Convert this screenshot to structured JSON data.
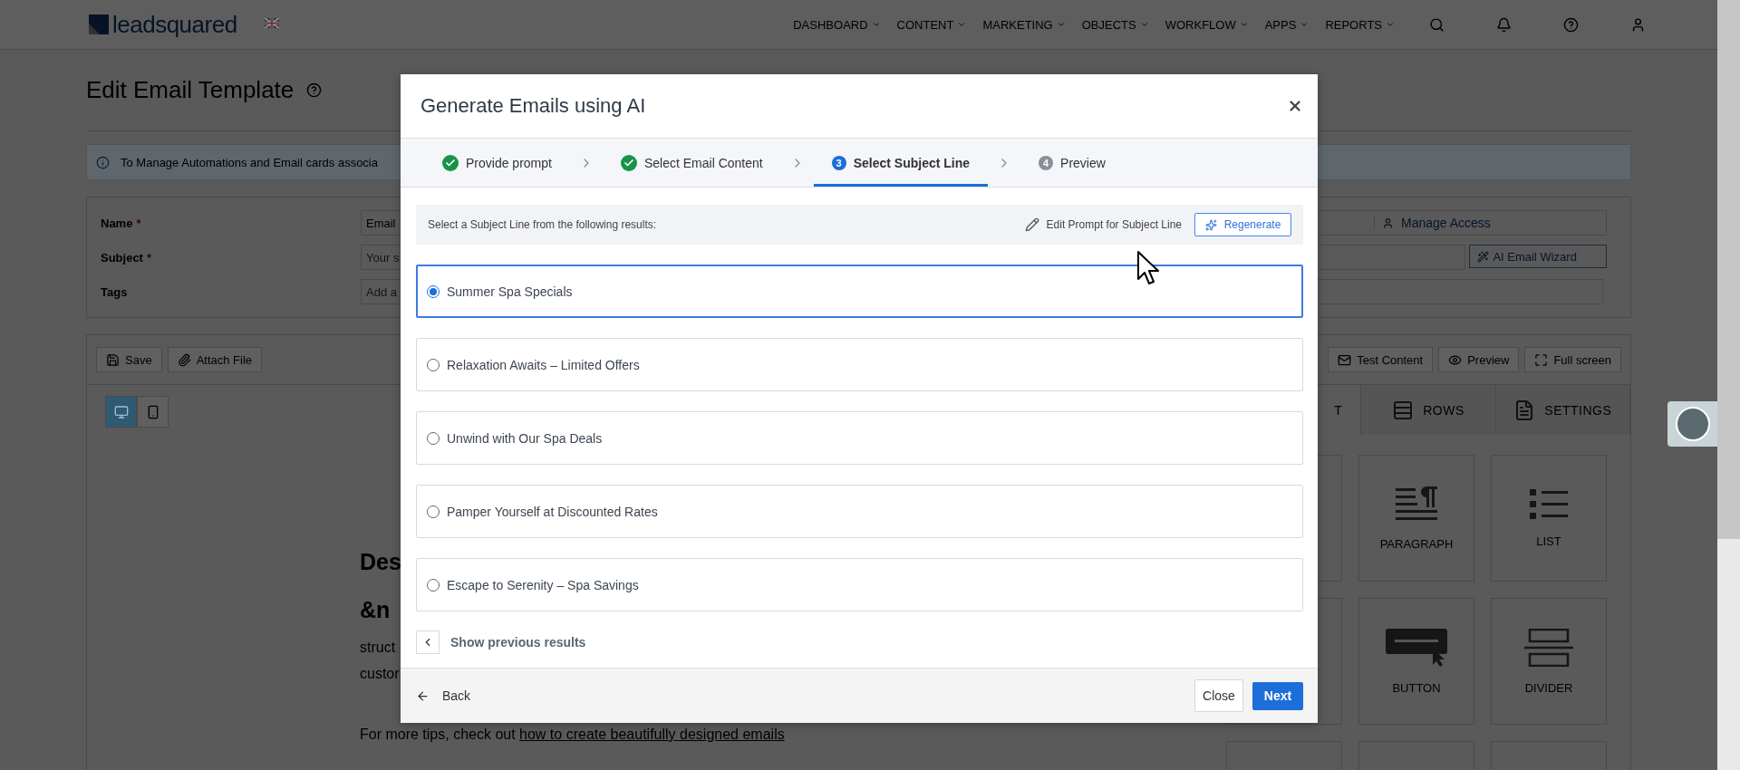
{
  "top_nav": {
    "logo": "leadsquared",
    "menu": [
      "DASHBOARD",
      "CONTENT",
      "MARKETING",
      "OBJECTS",
      "WORKFLOW",
      "APPS",
      "REPORTS"
    ]
  },
  "page": {
    "title": "Edit Email Template",
    "info_banner": "To Manage Automations and Email cards associa",
    "form": {
      "fields": [
        {
          "label": "Name",
          "mark": "*",
          "value": "Email"
        },
        {
          "label": "Subject",
          "mark": "*",
          "placeholder": "Your s"
        },
        {
          "label": "Tags",
          "placeholder": "Add a"
        }
      ],
      "manage_access": "Manage Access",
      "ai_wizard": "AI Email Wizard"
    },
    "toolbar": {
      "left": [
        {
          "kind": "save",
          "label": "Save"
        },
        {
          "kind": "attach",
          "label": "Attach File"
        }
      ],
      "right": [
        {
          "kind": "test",
          "label": "Test Content"
        },
        {
          "kind": "preview",
          "label": "Preview"
        },
        {
          "kind": "fullscreen",
          "label": "Full screen"
        }
      ]
    },
    "device_toggle": [
      {
        "kind": "desktop",
        "selected": true
      },
      {
        "kind": "mobile",
        "selected": false
      }
    ],
    "email_canvas": {
      "headings": [
        "Des",
        "&n"
      ],
      "body_lines": [
        "struct",
        "custor"
      ],
      "tip": "For more tips, check out ",
      "tip_link": "how to create beautifully designed emails"
    },
    "sidebar": {
      "tabs": [
        {
          "label": "T",
          "selected": true
        },
        {
          "label": "ROWS",
          "selected": false
        },
        {
          "label": "SETTINGS",
          "selected": false
        }
      ],
      "blocks": [
        {
          "kind": "paragraph",
          "label": "PARAGRAPH"
        },
        {
          "kind": "list",
          "label": "LIST"
        },
        {
          "kind": "button",
          "label": "BUTTON"
        },
        {
          "kind": "divider",
          "label": "DIVIDER"
        }
      ]
    }
  },
  "modal": {
    "title": "Generate Emails using AI",
    "steps": [
      {
        "label": "Provide prompt",
        "completed": true,
        "selected": false
      },
      {
        "label": "Select Email Content",
        "completed": true,
        "selected": false
      },
      {
        "number": "3",
        "label": "Select Subject Line",
        "completed": false,
        "selected": true
      },
      {
        "number": "4",
        "label": "Preview",
        "completed": false,
        "selected": false
      }
    ],
    "instruction": "Select a Subject Line from the following results:",
    "edit_prompt": "Edit Prompt for Subject Line",
    "regenerate": "Regenerate",
    "options": [
      {
        "text": "Summer Spa Specials",
        "selected": true
      },
      {
        "text": "Relaxation Awaits – Limited Offers",
        "selected": false
      },
      {
        "text": "Unwind with Our Spa Deals",
        "selected": false
      },
      {
        "text": "Pamper Yourself at Discounted Rates",
        "selected": false
      },
      {
        "text": "Escape to Serenity – Spa Savings",
        "selected": false
      }
    ],
    "show_previous": "Show previous results",
    "back": "Back",
    "close": "Close",
    "next": "Next"
  }
}
